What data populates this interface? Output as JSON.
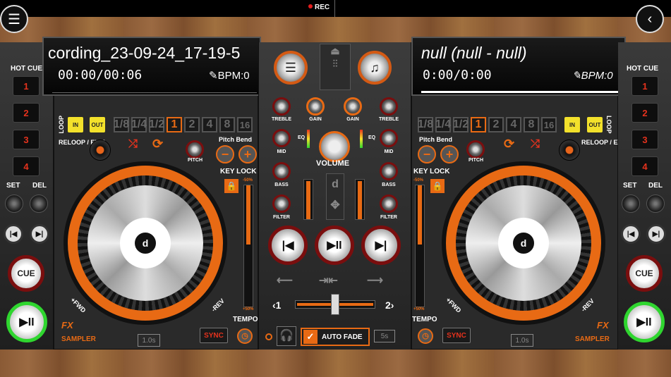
{
  "topbar": {
    "rec_label": "REC",
    "menu_icon": "menu-icon",
    "back_icon": "back-icon"
  },
  "colors": {
    "accent": "#e86a14",
    "rec": "#e51d1d",
    "play_ring": "#2fd62f",
    "loop_in_out": "#f3e12b"
  },
  "deckA": {
    "track_title": "cording_23-09-24_17-19-5",
    "time": "00:00/00:06",
    "bpm": "BPM:0",
    "hot_cue_label": "HOT CUE",
    "hot_cues": [
      "1",
      "2",
      "3",
      "4"
    ],
    "set_label": "SET",
    "del_label": "DEL",
    "cue_label": "CUE",
    "play_symbol": "▶II",
    "loop_label": "LOOP",
    "in_label": "IN",
    "out_label": "OUT",
    "loop_sizes": [
      "1/8",
      "1/4",
      "1/2",
      "1",
      "2",
      "4",
      "8",
      "16"
    ],
    "loop_active": "1",
    "reloop_label": "RELOOP / EXIT",
    "pitch_label": "PITCH",
    "pitch_bend_label": "Pitch Bend",
    "key_lock_label": "KEY LOCK",
    "pitch_top": "-50%",
    "pitch_bottom": "+50%",
    "tempo_label": "TEMPO",
    "fwd_label": "+FWD",
    "rev_label": "-REV",
    "fx_label": "FX",
    "sampler_label": "SAMPLER",
    "sampler_time": "1.0s",
    "sync_label": "SYNC"
  },
  "deckB": {
    "track_title": "null (null - null)",
    "time": "0:00/0:00",
    "bpm": "BPM:0",
    "hot_cue_label": "HOT CUE",
    "hot_cues": [
      "1",
      "2",
      "3",
      "4"
    ],
    "set_label": "SET",
    "del_label": "DEL",
    "cue_label": "CUE",
    "play_symbol": "▶II",
    "loop_label": "LOOP",
    "in_label": "IN",
    "out_label": "OUT",
    "loop_sizes": [
      "1/8",
      "1/4",
      "1/2",
      "1",
      "2",
      "4",
      "8",
      "16"
    ],
    "loop_active": "1",
    "reloop_label": "RELOOP / EXIT",
    "pitch_label": "PITCH",
    "pitch_bend_label": "Pitch Bend",
    "key_lock_label": "KEY LOCK",
    "pitch_top": "-50%",
    "pitch_bottom": "+50%",
    "tempo_label": "TEMPO",
    "fwd_label": "+FWD",
    "rev_label": "-REV",
    "fx_label": "FX",
    "sampler_label": "SAMPLER",
    "sampler_time": "1.0s",
    "sync_label": "SYNC"
  },
  "mixer": {
    "treble_label": "TREBLE",
    "gain_label": "GAIN",
    "mid_label": "MID",
    "bass_label": "BASS",
    "filter_label": "FILTER",
    "eq_label": "EQ",
    "volume_label": "VOLUME",
    "cross_left": "‹1",
    "cross_right": "2›",
    "auto_fade_label": "AUTO FADE",
    "auto_fade_time": "5s",
    "auto_fade_checked": true
  }
}
